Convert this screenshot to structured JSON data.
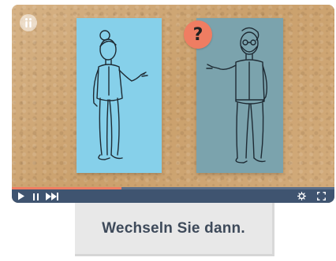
{
  "video": {
    "question_mark": "?",
    "progress_fraction": 0.34,
    "colors": {
      "background": "#cfa978",
      "left_card": "#86d0ea",
      "right_card": "#7ba3ad",
      "badge": "#ef7d62",
      "control_bar": "#3f5470"
    },
    "controls": {
      "play_icon": "play-icon",
      "pause_icon": "pause-icon",
      "next_icon": "skip-forward-icon",
      "settings_icon": "gear-icon",
      "fullscreen_icon": "fullscreen-icon"
    }
  },
  "caption": {
    "text": "Wechseln Sie dann."
  }
}
